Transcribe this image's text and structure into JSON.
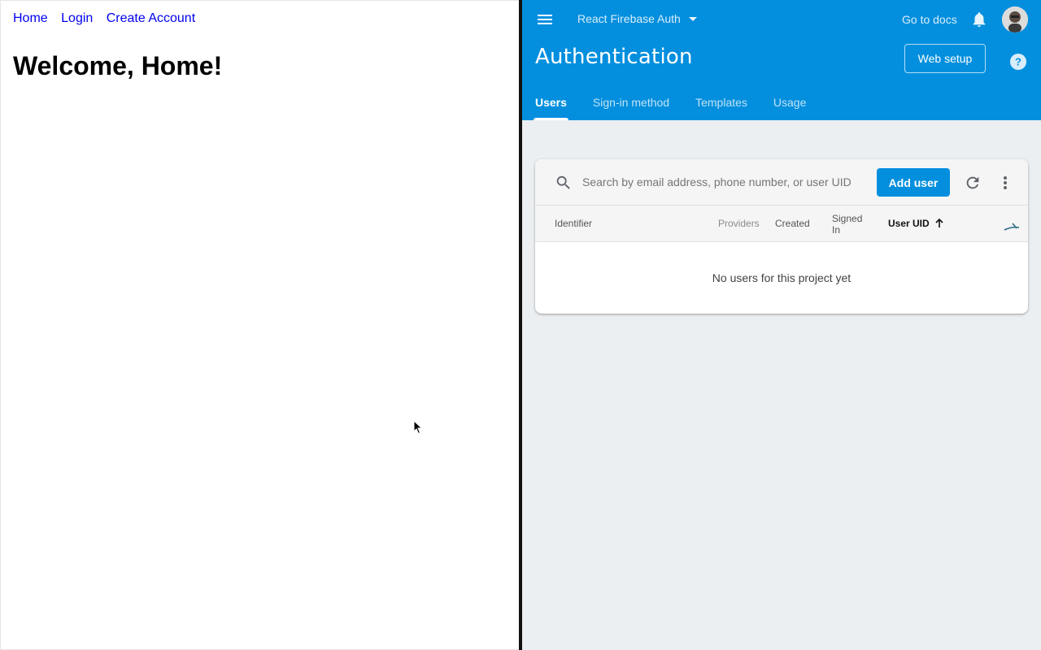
{
  "left_app": {
    "nav": [
      "Home",
      "Login",
      "Create Account"
    ],
    "heading": "Welcome, Home!",
    "link_color": "#0000ee"
  },
  "firebase": {
    "accent_color": "#038fde",
    "project_name": "React Firebase Auth",
    "docs_link": "Go to docs",
    "page_title": "Authentication",
    "web_setup_label": "Web setup",
    "tabs": [
      {
        "label": "Users",
        "active": true
      },
      {
        "label": "Sign-in method",
        "active": false
      },
      {
        "label": "Templates",
        "active": false
      },
      {
        "label": "Usage",
        "active": false
      }
    ],
    "icons": {
      "menu": "menu-icon",
      "project_caret": "chevron-down-icon",
      "bell": "bell-icon",
      "help": "help-icon",
      "search": "search-icon",
      "refresh": "refresh-icon",
      "more": "more-vert-icon",
      "sort": "arrow-up-icon",
      "columns": "column-settings-icon"
    },
    "users_table": {
      "search_placeholder": "Search by email address, phone number, or user UID",
      "add_user_label": "Add user",
      "columns": [
        "Identifier",
        "Providers",
        "Created",
        "Signed In",
        "User UID"
      ],
      "sorted_column": "User UID",
      "sort_direction": "ascending",
      "empty_message": "No users for this project yet"
    }
  }
}
